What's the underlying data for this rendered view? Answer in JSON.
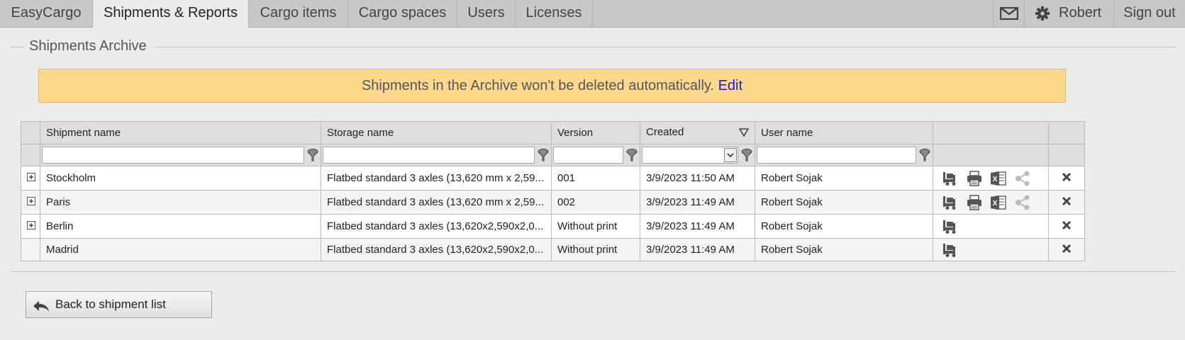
{
  "nav": {
    "tabs": [
      {
        "label": "EasyCargo"
      },
      {
        "label": "Shipments & Reports"
      },
      {
        "label": "Cargo items"
      },
      {
        "label": "Cargo spaces"
      },
      {
        "label": "Users"
      },
      {
        "label": "Licenses"
      }
    ],
    "user_label": "Robert",
    "signout_label": "Sign out"
  },
  "section": {
    "legend": "Shipments Archive",
    "notice_text": "Shipments in the Archive won't be deleted automatically.",
    "notice_link": "Edit"
  },
  "grid": {
    "columns": [
      "Shipment name",
      "Storage name",
      "Version",
      "Created",
      "User name"
    ],
    "rows": [
      {
        "name": "Stockholm",
        "storage": "Flatbed standard 3 axles (13,620 mm x 2,59...",
        "version": "001",
        "created": "3/9/2023 11:50 AM",
        "user": "Robert Sojak"
      },
      {
        "name": "Paris",
        "storage": "Flatbed standard 3 axles (13,620 mm x 2,59...",
        "version": "002",
        "created": "3/9/2023 11:49 AM",
        "user": "Robert Sojak"
      },
      {
        "name": "Berlin",
        "storage": "Flatbed standard 3 axles (13,620x2,590x2,0...",
        "version": "Without print",
        "created": "3/9/2023 11:49 AM",
        "user": "Robert Sojak"
      },
      {
        "name": "Madrid",
        "storage": "Flatbed standard 3 axles (13,620x2,590x2,0...",
        "version": "Without print",
        "created": "3/9/2023 11:49 AM",
        "user": "Robert Sojak"
      }
    ]
  },
  "back_button": {
    "label": "Back to shipment list"
  },
  "icons": {
    "nav_mail": "mail-icon",
    "nav_settings": "gear-icon",
    "filter": "funnel-icon",
    "sort": "sort-desc-icon",
    "expand": "plus-box-icon",
    "load": "forklift-icon",
    "print": "printer-icon",
    "excel": "excel-icon",
    "share": "share-icon",
    "delete": "close-icon",
    "back": "back-arrow-icon"
  }
}
